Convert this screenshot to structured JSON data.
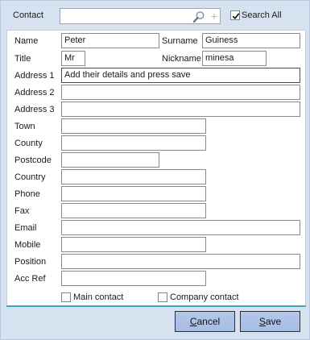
{
  "header": {
    "contact_label": "Contact",
    "contact_value": "",
    "search_all_label": "Search All",
    "search_all_checked": true,
    "search_icon": "search-icon",
    "add_icon": "plus-icon"
  },
  "form": {
    "name": {
      "label": "Name",
      "value": "Peter"
    },
    "surname": {
      "label": "Surname",
      "value": "Guiness"
    },
    "title": {
      "label": "Title",
      "value": "Mr"
    },
    "nickname": {
      "label": "Nickname",
      "value": "minesa"
    },
    "address1": {
      "label": "Address 1",
      "value": "Add their details and press save"
    },
    "address2": {
      "label": "Address 2",
      "value": ""
    },
    "address3": {
      "label": "Address 3",
      "value": ""
    },
    "town": {
      "label": "Town",
      "value": ""
    },
    "county": {
      "label": "County",
      "value": ""
    },
    "postcode": {
      "label": "Postcode",
      "value": ""
    },
    "country": {
      "label": "Country",
      "value": ""
    },
    "phone": {
      "label": "Phone",
      "value": ""
    },
    "fax": {
      "label": "Fax",
      "value": ""
    },
    "email": {
      "label": "Email",
      "value": ""
    },
    "mobile": {
      "label": "Mobile",
      "value": ""
    },
    "position": {
      "label": "Position",
      "value": ""
    },
    "acc_ref": {
      "label": "Acc Ref",
      "value": ""
    },
    "main_contact": {
      "label": "Main contact",
      "checked": false
    },
    "company_contact": {
      "label": "Company contact",
      "checked": false
    }
  },
  "buttons": {
    "cancel_rest": "ancel",
    "cancel_mnemonic": "C",
    "save_rest": "ave",
    "save_mnemonic": "S"
  },
  "colors": {
    "panel_bg": "#d6e2f0",
    "button_bg": "#adc2e6",
    "divider": "#3fa6b5"
  }
}
